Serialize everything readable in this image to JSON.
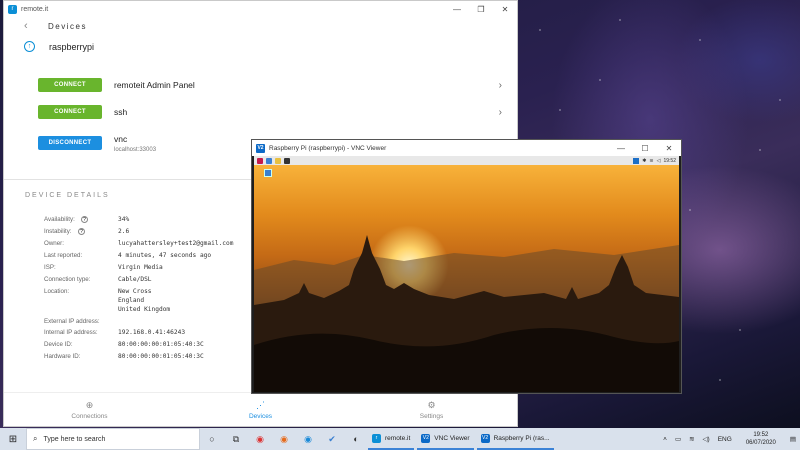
{
  "app": {
    "title": "remote.it",
    "nav_title": "Devices",
    "device_name": "raspberrypi",
    "services": [
      {
        "button": "CONNECT",
        "label": "remoteit Admin Panel",
        "sub": ""
      },
      {
        "button": "CONNECT",
        "label": "ssh",
        "sub": ""
      },
      {
        "button": "DISCONNECT",
        "label": "vnc",
        "sub": "localhost:33003"
      }
    ],
    "details_title": "DEVICE DETAILS",
    "details": {
      "availability_label": "Availability:",
      "availability": "34%",
      "instability_label": "Instability:",
      "instability": "2.6",
      "owner_label": "Owner:",
      "owner": "lucyahattersley+test2@gmail.com",
      "last_reported_label": "Last reported:",
      "last_reported": "4 minutes, 47 seconds ago",
      "isp_label": "ISP:",
      "isp": "Virgin Media",
      "connection_type_label": "Connection type:",
      "connection_type": "Cable/DSL",
      "location_label": "Location:",
      "location_1": "New Cross",
      "location_2": "England",
      "location_3": "United Kingdom",
      "external_ip_label": "External IP address:",
      "external_ip": "",
      "internal_ip_label": "Internal IP address:",
      "internal_ip": "192.168.0.41:46243",
      "device_id_label": "Device ID:",
      "device_id": "80:00:00:00:01:05:40:3C",
      "hardware_id_label": "Hardware ID:",
      "hardware_id": "80:00:00:00:01:05:40:3C"
    },
    "bottom_nav": {
      "connections": "Connections",
      "devices": "Devices",
      "settings": "Settings"
    }
  },
  "vnc": {
    "title": "Raspberry Pi (raspberrypi) - VNC Viewer",
    "logo": "V2",
    "tray_time": "19:52"
  },
  "taskbar": {
    "search_placeholder": "Type here to search",
    "apps": [
      {
        "label": "remote.it"
      },
      {
        "label": "VNC Viewer"
      },
      {
        "label": "Raspberry Pi (ras..."
      }
    ],
    "language": "ENG",
    "time": "19:52",
    "date": "06/07/2020"
  },
  "colors": {
    "green": "#69b52d",
    "blue": "#1c8fe0"
  }
}
